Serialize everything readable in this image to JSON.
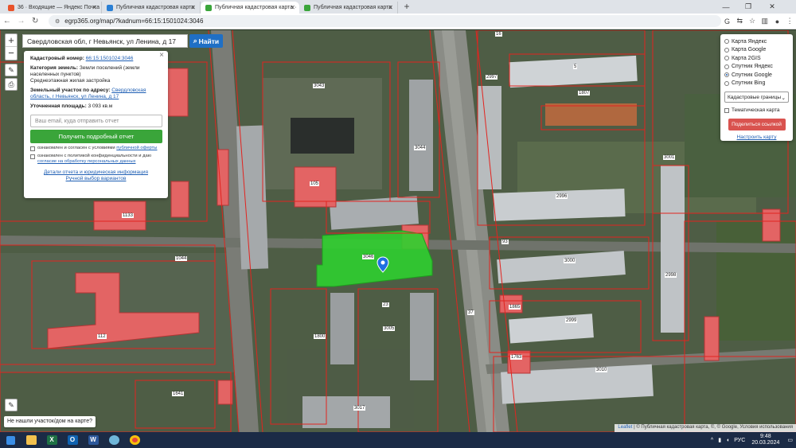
{
  "browser": {
    "tabs": [
      {
        "title": "36 · Входящие — Яндекс Почта",
        "fav_color": "#e9532b",
        "active": false
      },
      {
        "title": "Публичная кадастровая карта",
        "fav_color": "#2a7fd4",
        "active": false
      },
      {
        "title": "Публичная кадастровая карта ·",
        "fav_color": "#3aa53a",
        "active": true
      },
      {
        "title": "Публичная кадастровая карта",
        "fav_color": "#3aa53a",
        "active": false
      }
    ],
    "url": "egrp365.org/map/?kadnum=66:15:1501024:3046",
    "new_tab": "+"
  },
  "search": {
    "value": "Свердловская обл, г Невьянск, ул Ленина, д 17",
    "button": "Найти"
  },
  "zoom": {
    "in": "+",
    "out": "−"
  },
  "info_card": {
    "cad_label": "Кадастровый номер:",
    "cad_value": "66:15:1501024:3046",
    "cat_label": "Категория земель:",
    "cat_value": "Земли поселений (земли населенных пунктов)",
    "usage": "Среднеэтажная жилая застройка",
    "addr_label": "Земельный участок по адресу:",
    "addr_value": "Свердловская область, г Невьянск, ул Ленина, д 17",
    "area_label": "Уточненная площадь:",
    "area_value": "3 093 кв.м",
    "email_placeholder": "Ваш email, куда отправить отчет",
    "get_report": "Получить подробный отчет",
    "agree1_prefix": "ознакомлен и согласен с условиями",
    "agree1_link": "публичной оферты",
    "agree2_prefix": "ознакомлен с политикой конфиденциальности и даю",
    "agree2_link": "согласие на обработку персональных данных",
    "details_link": "Детали отчета и юридическая информация",
    "manual_link": "Ручной выбор вариантов"
  },
  "layers_panel": {
    "options": [
      {
        "label": "Карта Яндекс",
        "selected": false
      },
      {
        "label": "Карта Google",
        "selected": false
      },
      {
        "label": "Карта 2GIS",
        "selected": false
      },
      {
        "label": "Спутник Яндекс",
        "selected": false
      },
      {
        "label": "Спутник Google",
        "selected": true
      },
      {
        "label": "Спутник Bing",
        "selected": false
      }
    ],
    "select_value": "Кадастровые границы",
    "thematic": "Тематическая карта",
    "share": "Поделиться ссылкой",
    "configure": "Настроить карту"
  },
  "map_labels": {
    "l16": "16",
    "l5": "5",
    "l1807": "1807",
    "l2997": "2997",
    "l3043": "3043",
    "l3044": "3044",
    "l3046": "3046",
    "l2996": "2996",
    "l3000": "3000",
    "l2999": "2999",
    "l3010": "3010",
    "l1641": "1641",
    "l112": "112",
    "l1133": "1133",
    "l3005": "3005",
    "l23": "23",
    "l37": "37",
    "l93": "93",
    "l3001": "3001",
    "l1865": "1865",
    "l1763": "1763",
    "l3017": "3017",
    "l1800": "1800",
    "l2998": "2998",
    "l105": "105",
    "l1044": "1044"
  },
  "not_found": "Не нашли участок/дом на карте?",
  "attribution": {
    "leaflet": "Leaflet",
    "rest": "| © Публичная кадастровая карта, ©, © Google, Условия использования"
  },
  "taskbar": {
    "lang": "РУС",
    "time": "9:48",
    "date": "20.03.2024"
  },
  "colors": {
    "parcel": "#3bd43b",
    "boundary": "#e2241f",
    "building": "#e85a5a",
    "accent": "#1f6fc5"
  }
}
